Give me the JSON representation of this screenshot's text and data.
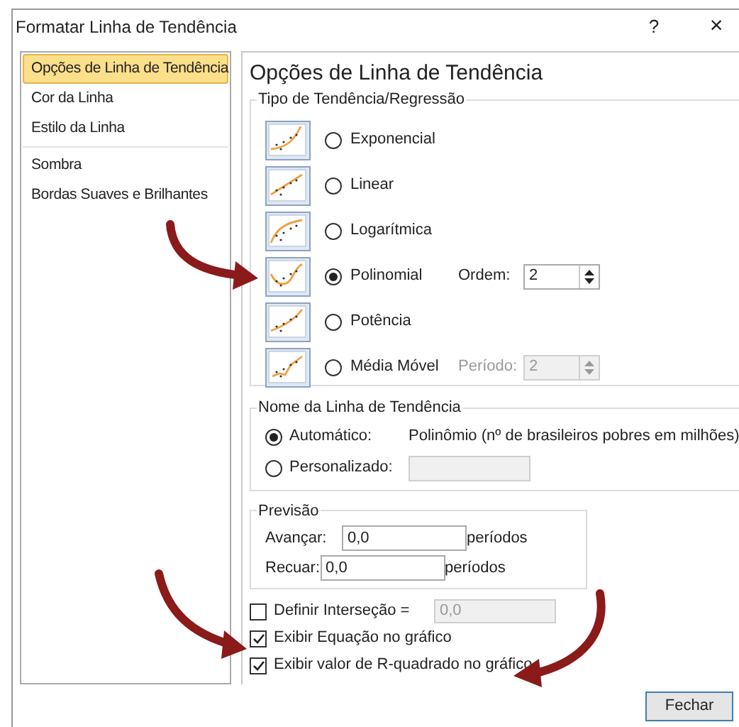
{
  "window": {
    "title": "Formatar Linha de Tendência",
    "help": "?",
    "close": "×"
  },
  "sidebar": {
    "groups": [
      {
        "items": [
          {
            "label": "Opções de Linha de Tendência",
            "selected": true
          },
          {
            "label": "Cor da Linha",
            "selected": false
          },
          {
            "label": "Estilo da Linha",
            "selected": false
          }
        ]
      },
      {
        "items": [
          {
            "label": "Sombra",
            "selected": false
          },
          {
            "label": "Bordas Suaves e Brilhantes",
            "selected": false
          }
        ]
      }
    ]
  },
  "panel_title": "Opções de Linha de Tendência",
  "trend_type": {
    "legend": "Tipo de Tendência/Regressão",
    "options": [
      {
        "kind": "exponential",
        "label": "Exponencial",
        "selected": false
      },
      {
        "kind": "linear",
        "label": "Linear",
        "selected": false
      },
      {
        "kind": "logarithmic",
        "label": "Logarítmica",
        "selected": false
      },
      {
        "kind": "polynomial",
        "label": "Polinomial",
        "selected": true,
        "field_label": "Ordem:",
        "field_value": "2",
        "field_disabled": false
      },
      {
        "kind": "power",
        "label": "Potência",
        "selected": false
      },
      {
        "kind": "moving_average",
        "label": "Média Móvel",
        "selected": false,
        "field_label": "Período:",
        "field_value": "2",
        "field_disabled": true
      }
    ]
  },
  "trend_name": {
    "legend": "Nome da Linha de Tendência",
    "options": [
      {
        "kind": "text",
        "label": "Automático:",
        "selected": true,
        "value": "Polinômio (nº de brasileiros pobres em milhões)"
      },
      {
        "kind": "field",
        "label": "Personalizado:",
        "selected": false
      }
    ]
  },
  "forecast": {
    "legend": "Previsão",
    "rows": [
      {
        "label": "Avançar:",
        "value": "0,0",
        "unit": "períodos"
      },
      {
        "label": "Recuar:",
        "value": "0,0",
        "unit": "períodos"
      }
    ]
  },
  "checkboxes": [
    {
      "label": "Definir Interseção =",
      "checked": false,
      "value": "0,0"
    },
    {
      "label": "Exibir Equação no gráfico",
      "checked": true
    },
    {
      "label": "Exibir valor de R-quadrado no gráfico",
      "checked": true
    }
  ],
  "buttons": [
    "Fechar"
  ]
}
